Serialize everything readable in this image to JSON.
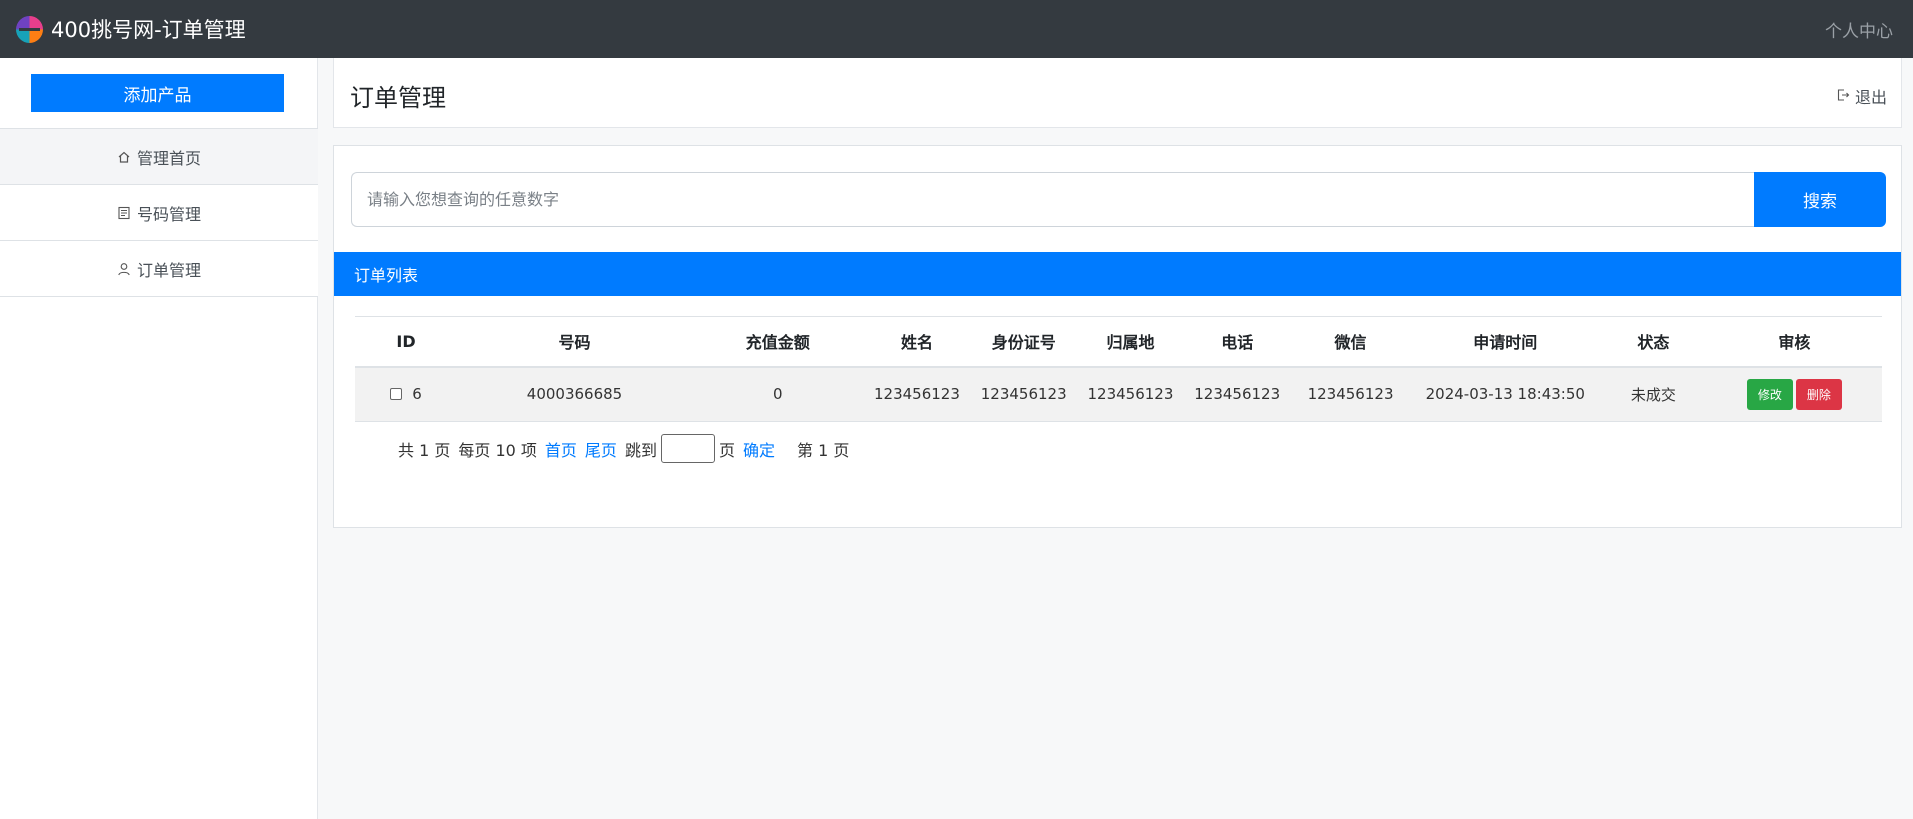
{
  "topbar": {
    "title": "400挑号网-订单管理",
    "user_center": "个人中心",
    "logo_icon": "colorful-circle-logo"
  },
  "sidebar": {
    "add_button": "添加产品",
    "items": [
      {
        "label": "管理首页",
        "icon": "home-icon",
        "active": true
      },
      {
        "label": "号码管理",
        "icon": "document-icon",
        "active": false
      },
      {
        "label": "订单管理",
        "icon": "user-icon",
        "active": false
      }
    ]
  },
  "header": {
    "title": "订单管理",
    "logout": "退出"
  },
  "search": {
    "placeholder": "请输入您想查询的任意数字",
    "button": "搜索"
  },
  "list": {
    "title": "订单列表",
    "columns": [
      "ID",
      "号码",
      "充值金额",
      "姓名",
      "身份证号",
      "归属地",
      "电话",
      "微信",
      "申请时间",
      "状态",
      "审核"
    ],
    "rows": [
      {
        "id": "6",
        "number": "4000366685",
        "amount": "0",
        "name": "123456123",
        "id_card": "123456123",
        "location": "123456123",
        "phone": "123456123",
        "wechat": "123456123",
        "time": "2024-03-13 18:43:50",
        "status": "未成交",
        "edit": "修改",
        "delete": "删除"
      }
    ]
  },
  "pager": {
    "total_pages": "共 1 页",
    "per_page": "每页 10 项",
    "first": "首页",
    "last": "尾页",
    "jump_to": "跳到",
    "page_unit": "页",
    "confirm": "确定",
    "current": "第 1 页"
  },
  "colors": {
    "topbar": "#343a40",
    "primary": "#007bff",
    "success": "#28a745",
    "danger": "#dc3545"
  }
}
